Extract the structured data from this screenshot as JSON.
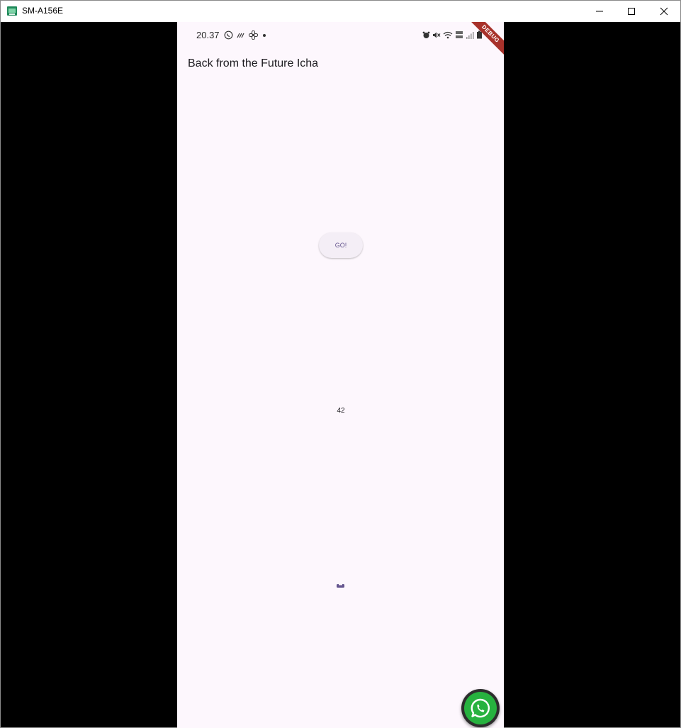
{
  "window": {
    "title": "SM-A156E"
  },
  "status_bar": {
    "time": "20.37",
    "left_icons": [
      "whatsapp-icon",
      "signal-wave-icon",
      "fan-icon",
      "dot-icon"
    ],
    "right_icons": [
      "alarm-icon",
      "mute-icon",
      "wifi-icon",
      "volte-icon",
      "signal-icon",
      "battery-icon"
    ]
  },
  "debug_banner": "DEBUG",
  "app_bar": {
    "title": "Back from the Future Icha"
  },
  "main": {
    "go_button_label": "GO!",
    "result": "42"
  },
  "fab": {
    "icon": "whatsapp-icon"
  },
  "colors": {
    "background": "#fdf7fd",
    "button_text": "#65558f",
    "button_bg": "#f4eef6",
    "progress": "#65558f",
    "debug": "#a8322b",
    "whatsapp": "#27b23f"
  }
}
